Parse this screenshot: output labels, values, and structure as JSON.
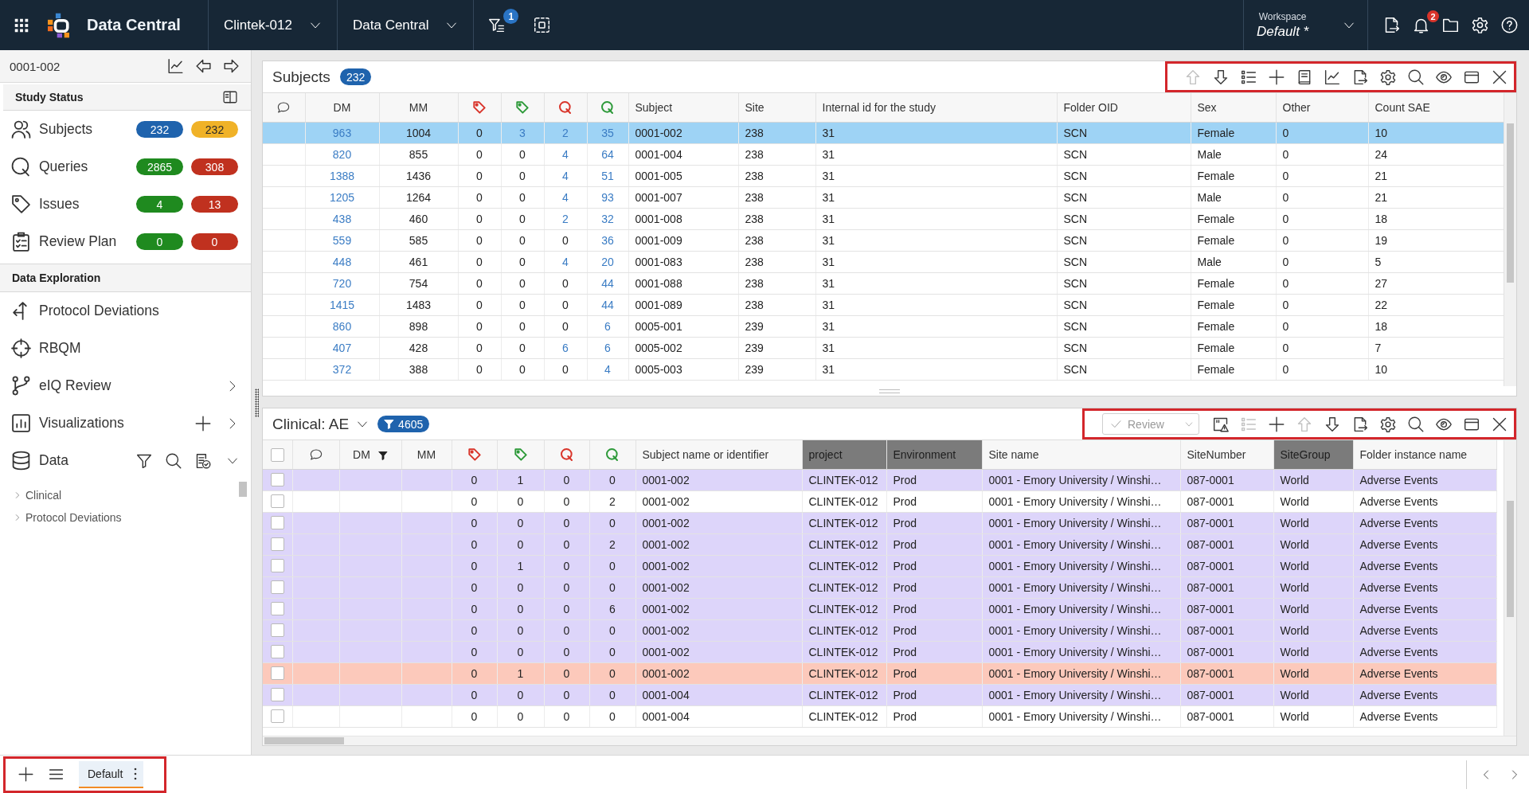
{
  "top_bar": {
    "app_name": "Data Central",
    "selectors": [
      {
        "label": "Clintek-012"
      },
      {
        "label": "Data Central"
      }
    ],
    "filter_badge": "1",
    "workspace": {
      "label": "Workspace",
      "value": "Default *"
    },
    "notification_badge": "2"
  },
  "sidebar": {
    "current_subject": "0001-002",
    "study_status": {
      "title": "Study Status",
      "items": [
        {
          "label": "Subjects",
          "badges": [
            {
              "text": "232",
              "color": "#1f63ad"
            },
            {
              "text": "232",
              "color": "#f0b228"
            }
          ]
        },
        {
          "label": "Queries",
          "badges": [
            {
              "text": "2865",
              "color": "#1f8a1f"
            },
            {
              "text": "308",
              "color": "#c0311f"
            }
          ]
        },
        {
          "label": "Issues",
          "badges": [
            {
              "text": "4",
              "color": "#1f8a1f"
            },
            {
              "text": "13",
              "color": "#c0311f"
            }
          ]
        },
        {
          "label": "Review Plan",
          "badges": [
            {
              "text": "0",
              "color": "#1f8a1f"
            },
            {
              "text": "0",
              "color": "#c0311f"
            }
          ]
        }
      ]
    },
    "data_exploration": {
      "title": "Data Exploration",
      "items": [
        {
          "label": "Protocol Deviations"
        },
        {
          "label": "RBQM"
        },
        {
          "label": "eIQ Review",
          "expanded": false
        },
        {
          "label": "Visualizations",
          "expanded": false,
          "actions": [
            {
              "kind": "add"
            }
          ]
        },
        {
          "label": "Data",
          "expanded": true,
          "actions": [
            {
              "kind": "filter"
            },
            {
              "kind": "search"
            },
            {
              "kind": "report"
            }
          ],
          "children": [
            {
              "label": "Clinical",
              "expanded": false
            },
            {
              "label": "Protocol Deviations",
              "expanded": false
            }
          ]
        }
      ]
    }
  },
  "subjects_panel": {
    "title": "Subjects",
    "count": "232",
    "toolbar": {
      "highlighted": true,
      "buttons": [
        {
          "kind": "up",
          "disabled": true
        },
        {
          "kind": "down",
          "disabled": false
        },
        {
          "kind": "list",
          "disabled": false
        },
        {
          "kind": "add",
          "disabled": false
        },
        {
          "kind": "book",
          "disabled": false
        },
        {
          "kind": "chart",
          "disabled": false
        },
        {
          "kind": "export",
          "disabled": false
        },
        {
          "kind": "settings",
          "disabled": false
        },
        {
          "kind": "search",
          "disabled": false
        },
        {
          "kind": "view",
          "disabled": false
        },
        {
          "kind": "window",
          "disabled": false
        },
        {
          "kind": "close",
          "disabled": false
        }
      ]
    },
    "table": {
      "columns": [
        {
          "kind": "comment"
        },
        {
          "kind": "number",
          "label": "DM"
        },
        {
          "kind": "number",
          "label": "MM"
        },
        {
          "kind": "tag",
          "color": "#d9352b"
        },
        {
          "kind": "tag",
          "color": "#2e9a3a"
        },
        {
          "kind": "query",
          "color": "#d9352b"
        },
        {
          "kind": "query",
          "color": "#2e9a3a"
        },
        {
          "kind": "text",
          "label": "Subject"
        },
        {
          "kind": "text",
          "label": "Site"
        },
        {
          "kind": "text",
          "label": "Internal id for the study"
        },
        {
          "kind": "text",
          "label": "Folder OID"
        },
        {
          "kind": "text",
          "label": "Sex"
        },
        {
          "kind": "text",
          "label": "Other"
        },
        {
          "kind": "text",
          "label": "Count SAE"
        }
      ],
      "rows": [
        {
          "selected": true,
          "cells": [
            "",
            {
              "text": "963",
              "link": true
            },
            "1004",
            "0",
            {
              "text": "3",
              "link": true
            },
            {
              "text": "2",
              "link": true
            },
            {
              "text": "35",
              "link": true
            },
            "0001-002",
            "238",
            "31",
            "SCN",
            "Female",
            "0",
            "10"
          ]
        },
        {
          "selected": false,
          "cells": [
            "",
            {
              "text": "820",
              "link": true
            },
            "855",
            "0",
            "0",
            {
              "text": "4",
              "link": true
            },
            {
              "text": "64",
              "link": true
            },
            "0001-004",
            "238",
            "31",
            "SCN",
            "Male",
            "0",
            "24"
          ]
        },
        {
          "selected": false,
          "cells": [
            "",
            {
              "text": "1388",
              "link": true
            },
            "1436",
            "0",
            "0",
            {
              "text": "4",
              "link": true
            },
            {
              "text": "51",
              "link": true
            },
            "0001-005",
            "238",
            "31",
            "SCN",
            "Female",
            "0",
            "21"
          ]
        },
        {
          "selected": false,
          "cells": [
            "",
            {
              "text": "1205",
              "link": true
            },
            "1264",
            "0",
            "0",
            {
              "text": "4",
              "link": true
            },
            {
              "text": "93",
              "link": true
            },
            "0001-007",
            "238",
            "31",
            "SCN",
            "Male",
            "0",
            "21"
          ]
        },
        {
          "selected": false,
          "cells": [
            "",
            {
              "text": "438",
              "link": true
            },
            "460",
            "0",
            "0",
            {
              "text": "2",
              "link": true
            },
            {
              "text": "32",
              "link": true
            },
            "0001-008",
            "238",
            "31",
            "SCN",
            "Female",
            "0",
            "18"
          ]
        },
        {
          "selected": false,
          "cells": [
            "",
            {
              "text": "559",
              "link": true
            },
            "585",
            "0",
            "0",
            "0",
            {
              "text": "36",
              "link": true
            },
            "0001-009",
            "238",
            "31",
            "SCN",
            "Female",
            "0",
            "19"
          ]
        },
        {
          "selected": false,
          "cells": [
            "",
            {
              "text": "448",
              "link": true
            },
            "461",
            "0",
            "0",
            {
              "text": "4",
              "link": true
            },
            {
              "text": "20",
              "link": true
            },
            "0001-083",
            "238",
            "31",
            "SCN",
            "Male",
            "0",
            "5"
          ]
        },
        {
          "selected": false,
          "cells": [
            "",
            {
              "text": "720",
              "link": true
            },
            "754",
            "0",
            "0",
            "0",
            {
              "text": "44",
              "link": true
            },
            "0001-088",
            "238",
            "31",
            "SCN",
            "Female",
            "0",
            "27"
          ]
        },
        {
          "selected": false,
          "cells": [
            "",
            {
              "text": "1415",
              "link": true
            },
            "1483",
            "0",
            "0",
            "0",
            {
              "text": "44",
              "link": true
            },
            "0001-089",
            "238",
            "31",
            "SCN",
            "Female",
            "0",
            "22"
          ]
        },
        {
          "selected": false,
          "cells": [
            "",
            {
              "text": "860",
              "link": true
            },
            "898",
            "0",
            "0",
            "0",
            {
              "text": "6",
              "link": true
            },
            "0005-001",
            "239",
            "31",
            "SCN",
            "Female",
            "0",
            "18"
          ]
        },
        {
          "selected": false,
          "cells": [
            "",
            {
              "text": "407",
              "link": true
            },
            "428",
            "0",
            "0",
            {
              "text": "6",
              "link": true
            },
            {
              "text": "6",
              "link": true
            },
            "0005-002",
            "239",
            "31",
            "SCN",
            "Female",
            "0",
            "7"
          ]
        },
        {
          "selected": false,
          "cells": [
            "",
            {
              "text": "372",
              "link": true
            },
            "388",
            "0",
            "0",
            "0",
            {
              "text": "4",
              "link": true
            },
            "0005-003",
            "239",
            "31",
            "SCN",
            "Female",
            "0",
            "10"
          ]
        }
      ]
    }
  },
  "clinical_panel": {
    "title": "Clinical: AE",
    "count": "4605",
    "count_filtered": true,
    "toolbar": {
      "highlighted": true,
      "review_button": {
        "label": "Review",
        "disabled": true
      },
      "buttons": [
        {
          "kind": "alert",
          "disabled": false
        },
        {
          "kind": "list",
          "disabled": true
        },
        {
          "kind": "add",
          "disabled": false
        },
        {
          "kind": "up",
          "disabled": true
        },
        {
          "kind": "down",
          "disabled": false
        },
        {
          "kind": "export",
          "disabled": false
        },
        {
          "kind": "settings",
          "disabled": false
        },
        {
          "kind": "search",
          "disabled": false
        },
        {
          "kind": "view",
          "disabled": false
        },
        {
          "kind": "window",
          "disabled": false
        },
        {
          "kind": "close",
          "disabled": false
        }
      ]
    },
    "table": {
      "all_checked": false,
      "columns": [
        {
          "kind": "checkbox",
          "filtered": false,
          "shaded": false
        },
        {
          "kind": "comment",
          "filtered": false,
          "shaded": false
        },
        {
          "kind": "number",
          "label": "DM",
          "filtered": true,
          "shaded": false
        },
        {
          "kind": "number",
          "label": "MM",
          "filtered": false,
          "shaded": false
        },
        {
          "kind": "tag",
          "color": "#d9352b",
          "filtered": false,
          "shaded": false
        },
        {
          "kind": "tag",
          "color": "#2e9a3a",
          "filtered": false,
          "shaded": false
        },
        {
          "kind": "query",
          "color": "#d9352b",
          "filtered": false,
          "shaded": false
        },
        {
          "kind": "query",
          "color": "#2e9a3a",
          "filtered": false,
          "shaded": false
        },
        {
          "kind": "text",
          "label": "Subject name or identifier",
          "filtered": false,
          "shaded": false
        },
        {
          "kind": "text",
          "label": "project",
          "filtered": false,
          "shaded": true
        },
        {
          "kind": "text",
          "label": "Environment",
          "filtered": false,
          "shaded": true
        },
        {
          "kind": "text",
          "label": "Site name",
          "filtered": false,
          "shaded": false
        },
        {
          "kind": "text",
          "label": "SiteNumber",
          "filtered": false,
          "shaded": false
        },
        {
          "kind": "text",
          "label": "SiteGroup",
          "filtered": false,
          "shaded": true
        },
        {
          "kind": "text",
          "label": "Folder instance name",
          "filtered": false,
          "shaded": false
        }
      ],
      "rows": [
        {
          "checked": false,
          "color": "#ddd5fa",
          "cells": [
            "",
            "",
            "",
            "",
            "0",
            "1",
            "0",
            "0",
            "0001-002",
            "CLINTEK-012",
            "Prod",
            "0001 - Emory University / Winshi…",
            "087-0001",
            "World",
            "Adverse Events"
          ]
        },
        {
          "checked": false,
          "color": "#ffffff",
          "cells": [
            "",
            "",
            "",
            "",
            "0",
            "0",
            "0",
            "2",
            "0001-002",
            "CLINTEK-012",
            "Prod",
            "0001 - Emory University / Winshi…",
            "087-0001",
            "World",
            "Adverse Events"
          ]
        },
        {
          "checked": false,
          "color": "#ddd5fa",
          "cells": [
            "",
            "",
            "",
            "",
            "0",
            "0",
            "0",
            "0",
            "0001-002",
            "CLINTEK-012",
            "Prod",
            "0001 - Emory University / Winshi…",
            "087-0001",
            "World",
            "Adverse Events"
          ]
        },
        {
          "checked": false,
          "color": "#ddd5fa",
          "cells": [
            "",
            "",
            "",
            "",
            "0",
            "0",
            "0",
            "2",
            "0001-002",
            "CLINTEK-012",
            "Prod",
            "0001 - Emory University / Winshi…",
            "087-0001",
            "World",
            "Adverse Events"
          ]
        },
        {
          "checked": false,
          "color": "#ddd5fa",
          "cells": [
            "",
            "",
            "",
            "",
            "0",
            "1",
            "0",
            "0",
            "0001-002",
            "CLINTEK-012",
            "Prod",
            "0001 - Emory University / Winshi…",
            "087-0001",
            "World",
            "Adverse Events"
          ]
        },
        {
          "checked": false,
          "color": "#ddd5fa",
          "cells": [
            "",
            "",
            "",
            "",
            "0",
            "0",
            "0",
            "0",
            "0001-002",
            "CLINTEK-012",
            "Prod",
            "0001 - Emory University / Winshi…",
            "087-0001",
            "World",
            "Adverse Events"
          ]
        },
        {
          "checked": false,
          "color": "#ddd5fa",
          "cells": [
            "",
            "",
            "",
            "",
            "0",
            "0",
            "0",
            "6",
            "0001-002",
            "CLINTEK-012",
            "Prod",
            "0001 - Emory University / Winshi…",
            "087-0001",
            "World",
            "Adverse Events"
          ]
        },
        {
          "checked": false,
          "color": "#ddd5fa",
          "cells": [
            "",
            "",
            "",
            "",
            "0",
            "0",
            "0",
            "0",
            "0001-002",
            "CLINTEK-012",
            "Prod",
            "0001 - Emory University / Winshi…",
            "087-0001",
            "World",
            "Adverse Events"
          ]
        },
        {
          "checked": false,
          "color": "#ddd5fa",
          "cells": [
            "",
            "",
            "",
            "",
            "0",
            "0",
            "0",
            "0",
            "0001-002",
            "CLINTEK-012",
            "Prod",
            "0001 - Emory University / Winshi…",
            "087-0001",
            "World",
            "Adverse Events"
          ]
        },
        {
          "checked": false,
          "color": "#fcc9bb",
          "cells": [
            "",
            "",
            "",
            "",
            "0",
            "1",
            "0",
            "0",
            "0001-002",
            "CLINTEK-012",
            "Prod",
            "0001 - Emory University / Winshi…",
            "087-0001",
            "World",
            "Adverse Events"
          ]
        },
        {
          "checked": false,
          "color": "#ddd5fa",
          "cells": [
            "",
            "",
            "",
            "",
            "0",
            "0",
            "0",
            "0",
            "0001-004",
            "CLINTEK-012",
            "Prod",
            "0001 - Emory University / Winshi…",
            "087-0001",
            "World",
            "Adverse Events"
          ]
        },
        {
          "checked": false,
          "color": "#ffffff",
          "cells": [
            "",
            "",
            "",
            "",
            "0",
            "0",
            "0",
            "0",
            "0001-004",
            "CLINTEK-012",
            "Prod",
            "0001 - Emory University / Winshi…",
            "087-0001",
            "World",
            "Adverse Events"
          ]
        }
      ]
    }
  },
  "bottom_bar": {
    "highlighted": true,
    "tabs": [
      {
        "label": "Default",
        "selected": true
      }
    ]
  }
}
